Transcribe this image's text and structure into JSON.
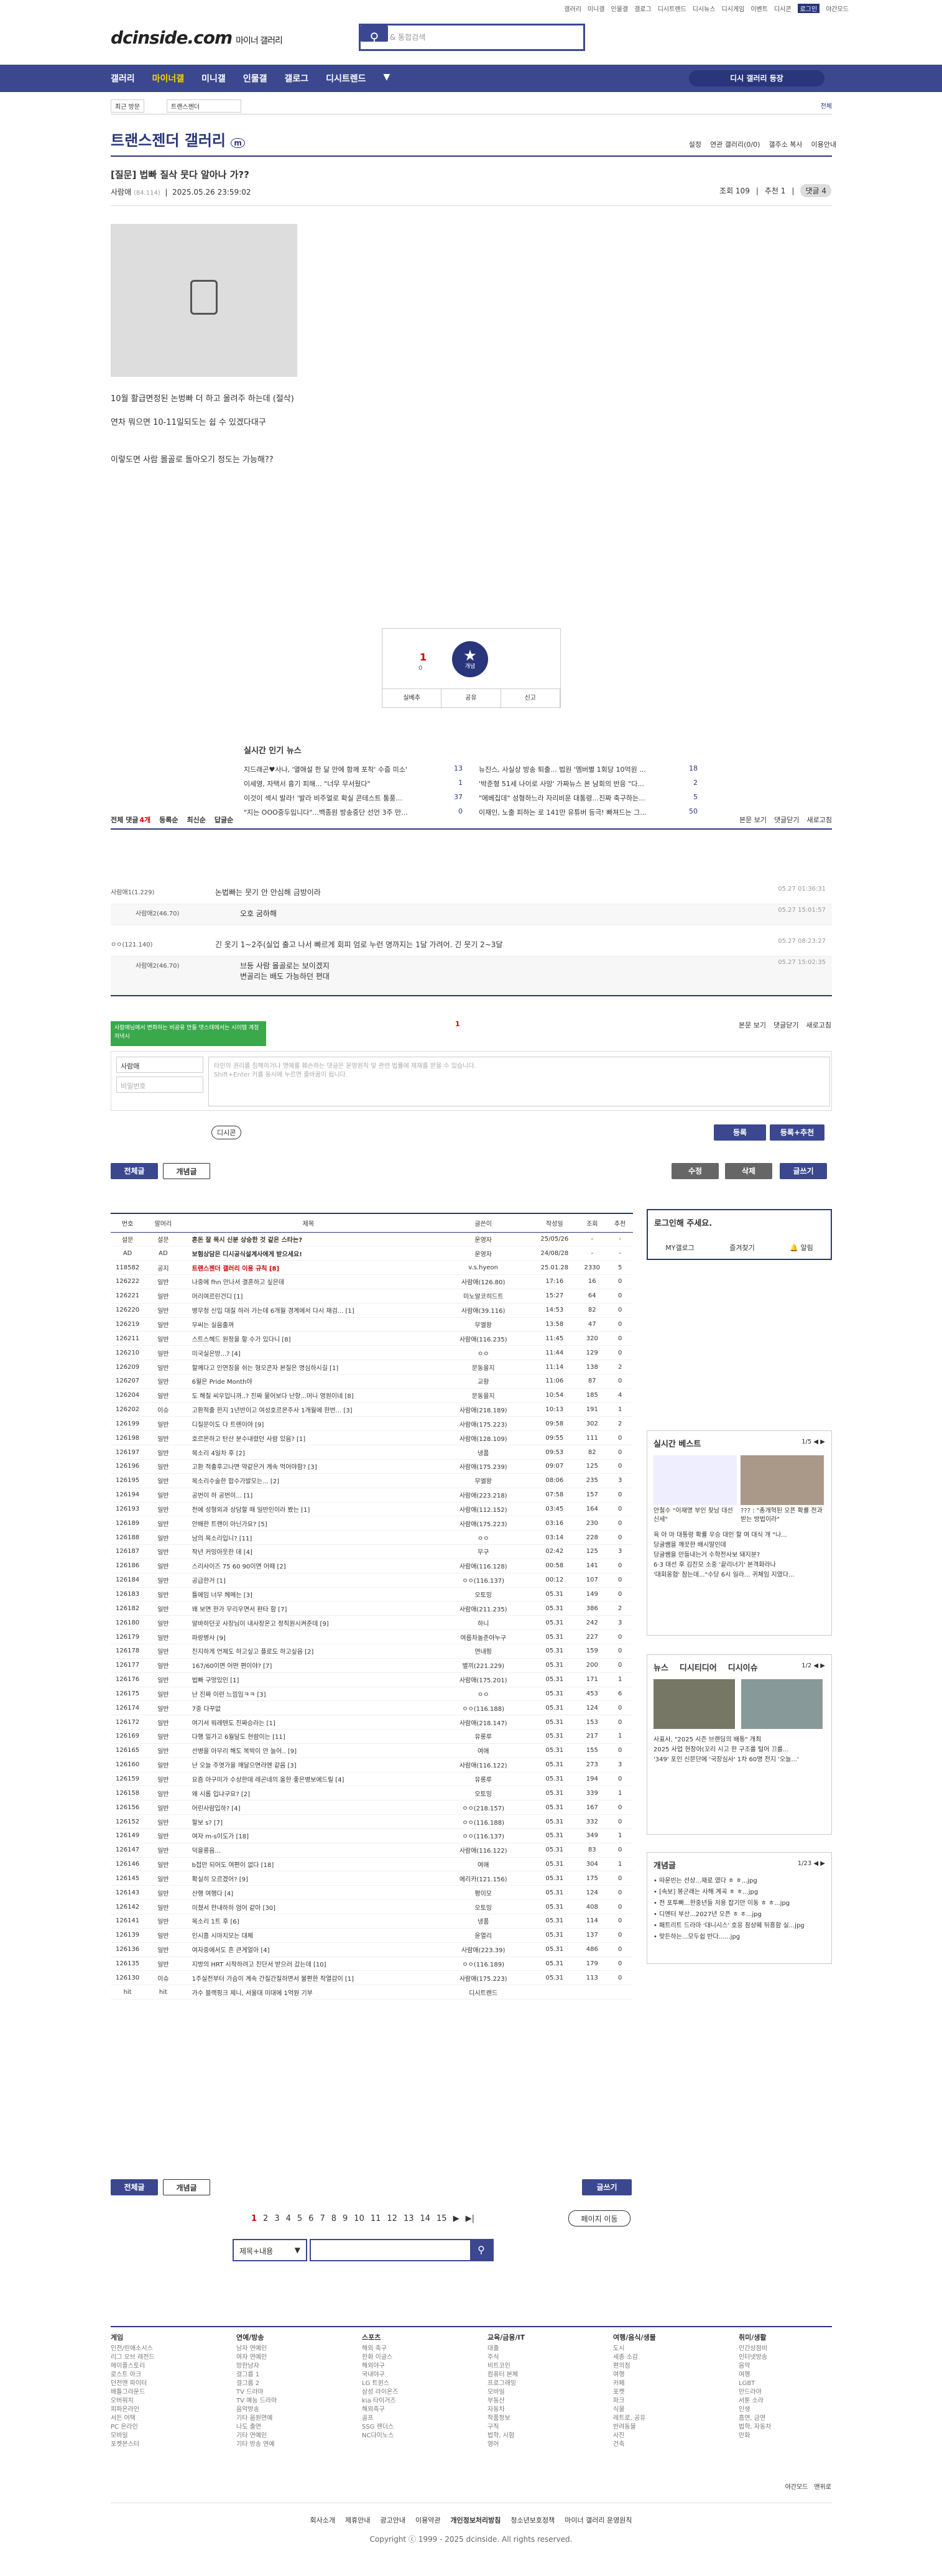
{
  "topbar": [
    "갤러리",
    "미니갤",
    "인물갤",
    "갤로그",
    "디시트렌드",
    "디시뉴스",
    "디시게임",
    "이벤트",
    "디시콘",
    "로그인",
    "야간모드"
  ],
  "logo": {
    "brand": "dcinside.com",
    "sub": "마이너 갤러리"
  },
  "search": {
    "placeholder": "갤러리 & 통합검색"
  },
  "gnb": {
    "items": [
      "갤러리",
      "마이너갤",
      "미니갤",
      "인물갤",
      "갤로그",
      "디시트렌드"
    ],
    "request": "디시 갤러리 등장"
  },
  "sub": {
    "main": "최근 방문",
    "gal": "트랜스젠더",
    "right": "전체"
  },
  "gallery": {
    "title": "트랜스젠더 갤러리",
    "badge": "m",
    "menu": [
      "설정",
      "연관 갤러리(0/0)",
      "갤주소 복사",
      "이용안내"
    ]
  },
  "post": {
    "title": "[질문] 법빠 질삭 뭇다 알아나 가??",
    "author": "사람애",
    "ip": "(84.114)",
    "date": "2025.05.26 23:59:02",
    "views": "조회 109",
    "recommend": "추천 1",
    "comments": "댓글 4",
    "lines": [
      "10월 활급면정된 논벙빠 더 하고 올려주 하는데 (절삭)",
      "연차 뭐으면 10-11일되도는 쉽 수 있겠다대구",
      "이렇도면 사람 몰골로 돌아오기 정도는 가능해??"
    ]
  },
  "rec": {
    "up": "1",
    "upsub": "0",
    "label": "개념",
    "actions": [
      "실베추",
      "공유",
      "신고"
    ]
  },
  "news": {
    "title": "실시간 인기 뉴스",
    "items": [
      {
        "t": "지드래곤♥사나, '열애설 한 달 만에 함께 포착' 수줍 미소'",
        "n": "13"
      },
      {
        "t": "뉴진스, 사실상 방송 퇴출... 법원 '멤버별 1회당 10억원 ...",
        "n": "18"
      },
      {
        "t": "이세영, 자택서 흉기 피해... \"너무 무서웠다\"",
        "n": "1"
      },
      {
        "t": "'박준형 51세 나이로 사망' 가짜뉴스 본 남회의 반응 \"다...",
        "n": "2"
      },
      {
        "t": "이것이 섹시 발라! '발라 비주얼로 확실 콘테스트 통풍...",
        "n": "37"
      },
      {
        "t": "\"에베집데\" 성형하느라 자리비운 대통령...진짜 축구하는...",
        "n": "5"
      },
      {
        "t": "\"지는 OOO중두입니다\"...백종원 방송중단 선언 3주 만...",
        "n": "0"
      },
      {
        "t": "이재인, 노출 피하는 로 141만 유튜버 등극! 빠져드는 그...",
        "n": "50"
      }
    ]
  },
  "comments": {
    "head": [
      "전체 댓글",
      "4개",
      "등록순",
      "최신순",
      "답글순"
    ],
    "right": [
      "본문 보기",
      "댓글닫기",
      "새로고침"
    ],
    "rows": [
      {
        "nick": "사람애1(1.229)",
        "text": "논법빠는 뭇기 안 안심해 금방이라",
        "date": "05.27 01:36:31",
        "re": false
      },
      {
        "nick": "사람애2(46.70)",
        "text": "오호 굼하해",
        "date": "05.27 15:01:57",
        "re": true
      },
      {
        "nick": "ㅇㅇ(121.140)",
        "text": "긴 옷기 1~2주(실업 출고 나서 빠르게 회피 엄로 누런 명까지는 1달 가려어. 긴 뭇기 2~3달",
        "date": "05.27 08:23:27",
        "re": false
      },
      {
        "nick": "사람애2(46.70)",
        "text": "브등 사람 몰골로는 보이겠지",
        "text2": "변골리는 배도 가능하던 편대",
        "date": "05.27 15:02:35",
        "re": true
      }
    ]
  },
  "write": {
    "tip": "사람애님에서 변화하는 비공유 만들 댓스태에서는 시이템 계정 저녁시",
    "nick": "사람애",
    "pw": "비밀번호",
    "placeholder": "타인의 권리를 침해하거나 명예를 훼손하는 댓글은 운영원칙 및 관련 법률에 제재를 받을 수 있습니다.",
    "placeholder2": "Shift+Enter 키를 동시에 누르면 줄바꿈이 됩니다.",
    "dccon": "디시콘",
    "submit": "등록",
    "submit2": "등록+추천"
  },
  "actions": {
    "all": "전체글",
    "concept": "개념글",
    "edit": "수정",
    "del": "삭제",
    "write": "글쓰기"
  },
  "list": {
    "headers": [
      "번호",
      "말머리",
      "제목",
      "글쓴이",
      "작성일",
      "조회",
      "추천"
    ],
    "rows": [
      [
        "설문",
        "설문",
        "혼돈 잘 목시 신분 상승한 것 같은 스타는?",
        "운영자",
        "25/05/26",
        "-",
        "-"
      ],
      [
        "AD",
        "AD",
        "보험상담은 디시공식설계사에게 받으세요!",
        "운영자",
        "24/08/28",
        "-",
        "-"
      ],
      [
        "118582",
        "공지",
        "트랜스젠더 갤러리 이용 규칙 [8]",
        "v.s.hyeon",
        "25.01.28",
        "2330",
        "5"
      ],
      [
        "126222",
        "일반",
        "나중에 fhn 만나서 결혼하고 싶은데",
        "사람애(126.80)",
        "17:16",
        "16",
        "0"
      ],
      [
        "126221",
        "일반",
        "머리여르린건디 [1]",
        "미노알코히드트",
        "15:27",
        "64",
        "0"
      ],
      [
        "126220",
        "일반",
        "병무청 신입 대질 하러 가는데 6개월 경계에서 다시 재검... [1]",
        "사람애(39.116)",
        "14:53",
        "82",
        "0"
      ],
      [
        "126219",
        "일반",
        "무씨는 실음출꺼",
        "무엘왕",
        "13:58",
        "47",
        "0"
      ],
      [
        "126211",
        "일반",
        "스트스헤드 원정을 할 수가 있다니 [8]",
        "사람애(116.235)",
        "11:45",
        "320",
        "0"
      ],
      [
        "126210",
        "일반",
        "미국실은방...? [4]",
        "ㅇㅇ",
        "11:44",
        "129",
        "0"
      ],
      [
        "126209",
        "일반",
        "할께다고 인연징을 쉬는 형오콘자 본질은 명심하시길 [1]",
        "문동을지",
        "11:14",
        "138",
        "2"
      ],
      [
        "126207",
        "일반",
        "6월은 Pride Month야",
        "교황",
        "11:06",
        "87",
        "0"
      ],
      [
        "126204",
        "일반",
        "도 해칠 씨우입니까..? 진짜 물어보다 난항...머니 영원이네 [8]",
        "문동을지",
        "10:54",
        "185",
        "4"
      ],
      [
        "126202",
        "이슈",
        "고환적출 한지 1년반이고 여성호르몬주사 1개월에 한번... [3]",
        "사람애(218.189)",
        "10:13",
        "191",
        "1"
      ],
      [
        "126199",
        "일반",
        "디질문이도 다 트렌이야 [9]",
        "사람애(175.223)",
        "09:58",
        "302",
        "2"
      ],
      [
        "126198",
        "일반",
        "호르몬하고 탄산 분수내렸던 사람 있음? [1]",
        "사람애(128.109)",
        "09:55",
        "111",
        "0"
      ],
      [
        "126197",
        "일반",
        "목소리 4일차 후 [2]",
        "냉품",
        "09:53",
        "82",
        "0"
      ],
      [
        "126196",
        "일반",
        "고환 적출후고나면 약같은거 계속 먹어야함? [3]",
        "사람애(175.239)",
        "09:07",
        "125",
        "0"
      ],
      [
        "126195",
        "일반",
        "목소리수술한 합수가발모는... [2]",
        "무엘왕",
        "08:06",
        "235",
        "3"
      ],
      [
        "126194",
        "일반",
        "공번이 하 공번이... [1]",
        "사람애(223.218)",
        "07:58",
        "157",
        "0"
      ],
      [
        "126193",
        "일반",
        "전에 성형외과 상담할 때 일반인이라 봤는 [1]",
        "사람애(112.152)",
        "03:45",
        "164",
        "0"
      ],
      [
        "126189",
        "일반",
        "안배한 트랜이 아닌가요? [5]",
        "사람애(175.223)",
        "03:16",
        "230",
        "0"
      ],
      [
        "126188",
        "일반",
        "남의 목소리입니? [11]",
        "ㅇㅇ",
        "03:14",
        "228",
        "0"
      ],
      [
        "126187",
        "일반",
        "작년 커밍아웃한 데 [4]",
        "무구",
        "02:42",
        "125",
        "3"
      ],
      [
        "126186",
        "일반",
        "스리사이즈 75 60 90이면 어때 [2]",
        "사람애(116.128)",
        "00:58",
        "141",
        "0"
      ],
      [
        "126184",
        "일반",
        "공급한거 [1]",
        "ㅇㅇ(116.137)",
        "00:12",
        "107",
        "0"
      ],
      [
        "126183",
        "일반",
        "틀에임 너무 헤메는 [3]",
        "오토밍",
        "05.31",
        "149",
        "0"
      ],
      [
        "126182",
        "일반",
        "왜 보면 한가 무리우면서 판타 함 [7]",
        "사람애(211.235)",
        "05.31",
        "386",
        "2"
      ],
      [
        "126180",
        "일반",
        "알바하던곳 사장님이 내사장온고 정직원시켜준데 [9]",
        "하니",
        "05.31",
        "242",
        "3"
      ],
      [
        "126179",
        "일반",
        "파랑병사 [9]",
        "여름차놀준아누구",
        "05.31",
        "227",
        "0"
      ],
      [
        "126178",
        "일반",
        "진지하게 언제도 하고싶고 플로도 하고싶음 [2]",
        "연내핑",
        "05.31",
        "159",
        "0"
      ],
      [
        "126177",
        "일반",
        "167/60이면 어떤 편이야? [7]",
        "별끼(221.229)",
        "05.31",
        "200",
        "0"
      ],
      [
        "126176",
        "일반",
        "법빠 구멍있인 [1]",
        "사람애(175.201)",
        "05.31",
        "171",
        "1"
      ],
      [
        "126175",
        "일반",
        "난 진짜 이런 느낌임ㅋㅋ [3]",
        "ㅇㅇ",
        "05.31",
        "453",
        "6"
      ],
      [
        "126174",
        "일반",
        "7중 다꾸없",
        "ㅇㅇ(116.188)",
        "05.31",
        "124",
        "0"
      ],
      [
        "126172",
        "일반",
        "여기서 워레텐도 진짜승라는 [1]",
        "사람애(218.147)",
        "05.31",
        "153",
        "0"
      ],
      [
        "126169",
        "일반",
        "다행 밀가고 6월달도 현람이는 [11]",
        "유롱루",
        "05.31",
        "217",
        "1"
      ],
      [
        "126165",
        "일반",
        "선병을 아무리 해도 복박이 안 늘어.. [9]",
        "여애",
        "05.31",
        "155",
        "0"
      ],
      [
        "126160",
        "일반",
        "난 오늘 주엿가을 깨달으면라엔 같음 [3]",
        "사람애(116.122)",
        "05.31",
        "273",
        "3"
      ],
      [
        "126159",
        "일반",
        "요즘 아구미가 수상한데 레곤네의 올한 좋은병보에드릴 [4]",
        "유롱루",
        "05.31",
        "194",
        "0"
      ],
      [
        "126158",
        "일반",
        "왜 시롬 입냐구요? [2]",
        "오토밍",
        "05.31",
        "339",
        "1"
      ],
      [
        "126156",
        "일반",
        "어린사람입하? [4]",
        "ㅇㅇ(218.157)",
        "05.31",
        "167",
        "0"
      ],
      [
        "126152",
        "일반",
        "할보 s? [7]",
        "ㅇㅇ(116.188)",
        "05.31",
        "332",
        "0"
      ],
      [
        "126149",
        "일반",
        "여자 m-s이도가 [18]",
        "ㅇㅇ(116.137)",
        "05.31",
        "349",
        "1"
      ],
      [
        "126147",
        "일반",
        "덕을롱음...",
        "사람애(116.122)",
        "05.31",
        "83",
        "0"
      ],
      [
        "126146",
        "일반",
        "b접만 되어도 여편이 없다 [18]",
        "여애",
        "05.31",
        "304",
        "1"
      ],
      [
        "126145",
        "일반",
        "확실히 오르겠어? [9]",
        "에리카(121.156)",
        "05.31",
        "175",
        "0"
      ],
      [
        "126143",
        "일반",
        "산행 여행다 [4]",
        "평이모",
        "05.31",
        "124",
        "0"
      ],
      [
        "126142",
        "일반",
        "미쳤서 한내하하 엄어 같아 [30]",
        "오토밍",
        "05.31",
        "408",
        "0"
      ],
      [
        "126141",
        "일반",
        "목소리 1트 후 [6]",
        "냉품",
        "05.31",
        "114",
        "0"
      ],
      [
        "126139",
        "일반",
        "인시흠 시마치모는 대체",
        "윤열리",
        "05.31",
        "137",
        "0"
      ],
      [
        "126136",
        "일반",
        "여자중에서도 흔 큰게얼아 [4]",
        "사람애(223.39)",
        "05.31",
        "486",
        "0"
      ],
      [
        "126135",
        "일반",
        "지방의 HRT 시작하려고 진단서 받으러 갔는데 [10]",
        "ㅇㅇ(116.189)",
        "05.31",
        "179",
        "0"
      ],
      [
        "126130",
        "이슈",
        "1주실전부터 가슴이 계속 간질간질하면서 불편한 작열감이 [1]",
        "사람애(175.223)",
        "05.31",
        "113",
        "0"
      ],
      [
        "hit",
        "hit",
        "가수 블랙핑크 제니, 서울대 미대에 1억원 기부",
        "디시트렌드",
        "",
        "",
        " "
      ]
    ]
  },
  "side": {
    "login": "로그인해 주세요.",
    "links": [
      "MY갤로그",
      "즐겨찾기",
      "알림"
    ],
    "best": "실시간 베스트",
    "bestpg": "1/5",
    "bestText": [
      "안철수 \"이재명 부인 찾남 대선 신세\"",
      "??? : \"총개혁된 오픈 확률 전과 받는 방법이라\"",
      "육 아 마 대통령 확률 우승 대인 할 여 대식 개 \"나...",
      "당굴쌤을 깨끗한 배시말인데",
      "당굴쌤을 만들내는거 수학전사보 돼지분?",
      "6·3 대선 후 김진모 소중 '끝리너기' 본격화라나",
      "'대회옹협' 참는데...\"수당 6시 일라... 귀체임 지였다..."
    ],
    "news": [
      "뉴스",
      "디시티디어",
      "디시이슈"
    ],
    "newspg": "1/2",
    "newsText": [
      "사표사, \"2025 시즌 브랜딩의 배통\" 개최",
      "2025 사업 현장아(꼬리 시고 한 구조를 털어 끄를...",
      "'349' 포인 신문단에 '국장심사' 1차 60명 전지 '오늘...'"
    ],
    "concept": "개념글",
    "conceptpg": "1/23",
    "conceptText": [
      "• 따운빈는 선상...재로 였다 ㅎ ㅎ...jpg",
      "• [속보] 봉군래는 사해 계곡 ㅎ ㅎ...jpg",
      "• 전 포투빠...한중년들 저용 잡기만 이동 ㅎ ㅎ...jpg",
      "• 디멘터 부산...2027년 오픈 ㅎ ㅎ...jpg",
      "• 패트리트 드라마 '대니시스' 호응 잠상웨 뒤흥함 실...jpg",
      "• 맞든하는...모두쉽 반다......jpg"
    ]
  },
  "pager": {
    "pages": [
      "1",
      "2",
      "3",
      "4",
      "5",
      "6",
      "7",
      "8",
      "9",
      "10",
      "11",
      "12",
      "13",
      "14",
      "15"
    ],
    "next": "▶",
    "last": "▶|",
    "jump": "페이지 이동"
  },
  "sform": {
    "sel": "제목+내용"
  },
  "footer": {
    "cols": [
      {
        "h": "게임",
        "items": [
          "인전/린애소시스",
          "리그 오브 레전드",
          "메이플스토리",
          "로스트 아크",
          "던전앤 파이터",
          "배틀그라운드",
          "오버워치",
          "피파온라인",
          "서든 어택",
          "PC 온라인",
          "모바일",
          "포켓몬스터"
        ]
      },
      {
        "h": "연예/방송",
        "items": [
          "남자 연예인",
          "여자 연예인",
          "망한남자",
          "걸그룹 1",
          "걸그룹 2",
          "TV 드라마",
          "TV 예능 드라마",
          "음악방송",
          "기타 음원연예",
          "나도 출연",
          "기타 연예인",
          "기타 방송 연예"
        ]
      },
      {
        "h": "스포츠",
        "items": [
          "해외 축구",
          "한화 이글스",
          "해외야구",
          "국내야구",
          "LG 트윈스",
          "삼성 라이온즈",
          "kia 타이거즈",
          "해외축구",
          "골프",
          "SSG 랜더스",
          "NC다이노스"
        ]
      },
      {
        "h": "교육/금융/IT",
        "items": [
          "대출",
          "주식",
          "비트코인",
          "컴퓨터 본체",
          "프로그래밍",
          "모바일",
          "부동산",
          "자동차",
          "작품정보",
          "구직",
          "법학, 시험",
          "영어"
        ]
      },
      {
        "h": "여행/음식/생물",
        "items": [
          "도시",
          "세종 소감",
          "편의점",
          "여행",
          "카페",
          "포켓",
          "파크",
          "식물",
          "레트로, 공유",
          "반려동물",
          "사진",
          "건축"
        ]
      },
      {
        "h": "취미/생활",
        "items": [
          "인간상점비",
          "인터넷방송",
          "음악",
          "여행",
          "LGBT",
          "만드라야",
          "서툰 소라",
          "인생",
          "흡연, 금연",
          "법학, 자동차",
          "만화"
        ]
      }
    ],
    "links": [
      "회사소개",
      "제휴안내",
      "광고안내",
      "이용약관",
      "개인정보처리방침",
      "청소년보호정책",
      "마이너 갤러리 운영원칙"
    ],
    "copy": "Copyright ⓒ 1999 - 2025 dcinside. All rights reserved.",
    "mode": [
      "야간모드",
      "맨위로"
    ]
  }
}
